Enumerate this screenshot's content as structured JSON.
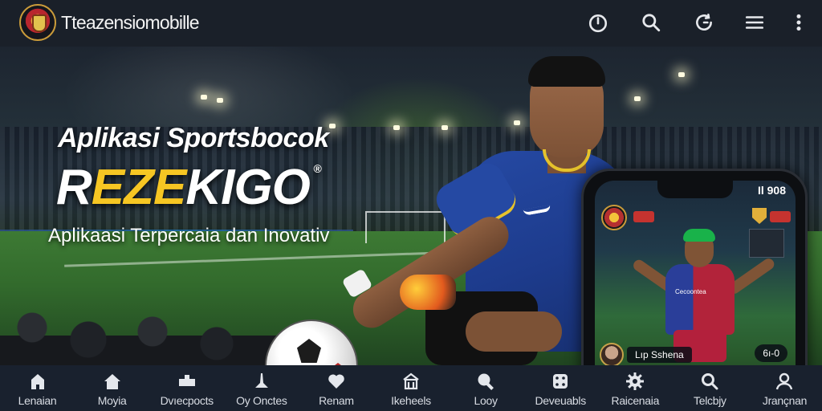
{
  "header": {
    "app_title": "Tteazensiomobille",
    "icons": [
      "power-icon",
      "search-icon",
      "refresh-icon",
      "menu-icon",
      "more-vertical-icon"
    ]
  },
  "hero": {
    "heading": "Aplikasi Sportsbocok",
    "brand_white_1": "R",
    "brand_yellow_1": "EZE",
    "brand_white_2": "KIGO",
    "brand_registered": "®",
    "tagline": "Aplikaasi Terpercaia dan Inovativ"
  },
  "phone": {
    "status_text": "Il 908",
    "jersey_text": "Cecoontea",
    "user_name": "Lıp Sshena",
    "score": "6ı-0"
  },
  "bottom_nav": {
    "items": [
      {
        "label": "Lenaian",
        "icon": "home-icon"
      },
      {
        "label": "Moyia",
        "icon": "house-icon"
      },
      {
        "label": "Dvıecpocts",
        "icon": "stadium-icon"
      },
      {
        "label": "Oy Onctes",
        "icon": "trophy-icon"
      },
      {
        "label": "Renam",
        "icon": "heart-icon"
      },
      {
        "label": "Ikeheels",
        "icon": "building-icon"
      },
      {
        "label": "Looy",
        "icon": "search-icon"
      },
      {
        "label": "Deveuabls",
        "icon": "dice-icon"
      },
      {
        "label": "Raicenaia",
        "icon": "gear-icon"
      },
      {
        "label": "Telcbjy",
        "icon": "search-icon"
      },
      {
        "label": "Jrançnan",
        "icon": "user-icon"
      }
    ]
  },
  "colors": {
    "topbar_bg": "#1a2029",
    "nav_bg": "#19212e",
    "brand_yellow": "#f6c623",
    "jersey_blue": "#2549a3"
  }
}
